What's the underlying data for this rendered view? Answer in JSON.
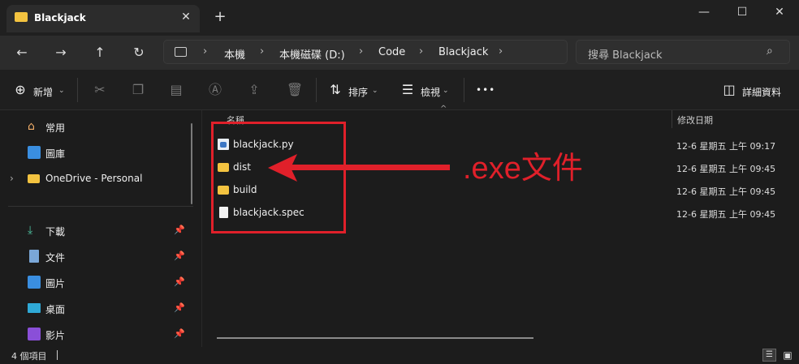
{
  "window": {
    "tab_title": "Blackjack",
    "new_tab": "+",
    "close_tab": "✕",
    "minimize": "—",
    "maximize": "☐",
    "close": "✕"
  },
  "address": {
    "crumbs": [
      "本機",
      "本機磁碟 (D:)",
      "Code",
      "Blackjack"
    ],
    "search_placeholder": "搜尋 Blackjack"
  },
  "toolbar": {
    "new_label": "新增",
    "sort_label": "排序",
    "view_label": "檢視",
    "more": "•••",
    "details_label": "詳細資料"
  },
  "nav": {
    "home": "常用",
    "gallery": "圖庫",
    "onedrive": "OneDrive - Personal",
    "downloads": "下載",
    "documents": "文件",
    "pictures": "圖片",
    "desktop": "桌面",
    "videos": "影片"
  },
  "columns": {
    "name": "名稱",
    "modified": "修改日期"
  },
  "files": [
    {
      "name": "blackjack.py",
      "date": "12-6 星期五 上午 09:17",
      "icon": "python-file-icon"
    },
    {
      "name": "dist",
      "date": "12-6 星期五 上午 09:45",
      "icon": "folder-icon"
    },
    {
      "name": "build",
      "date": "12-6 星期五 上午 09:45",
      "icon": "folder-icon"
    },
    {
      "name": "blackjack.spec",
      "date": "12-6 星期五 上午 09:45",
      "icon": "file-icon"
    }
  ],
  "annotation": ".exe文件",
  "status": {
    "count": "4 個項目"
  },
  "colors": {
    "accent_red": "#e0202a",
    "folder": "#f3c340"
  }
}
